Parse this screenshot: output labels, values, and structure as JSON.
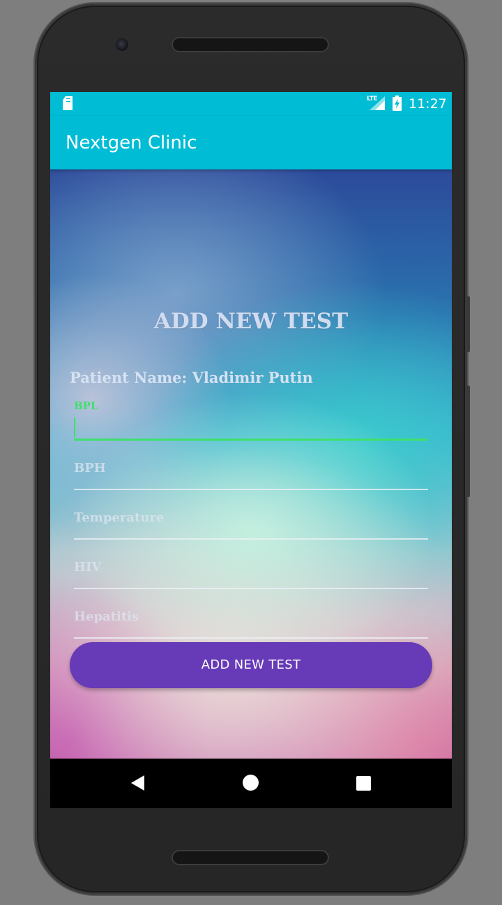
{
  "status_bar": {
    "network_label": "LTE",
    "time": "11:27",
    "icons": [
      "sd-card-icon",
      "signal-icon",
      "battery-charging-icon"
    ]
  },
  "app_bar": {
    "title": "Nextgen Clinic"
  },
  "form": {
    "heading": "ADD NEW TEST",
    "patient_line": "Patient Name: Vladimir Putin",
    "fields": [
      {
        "label": "BPL",
        "value": "",
        "focused": true
      },
      {
        "placeholder": "BPH",
        "value": ""
      },
      {
        "placeholder": "Temperature",
        "value": ""
      },
      {
        "placeholder": "HIV",
        "value": ""
      },
      {
        "placeholder": "Hepatitis",
        "value": ""
      }
    ],
    "submit_label": "ADD NEW TEST"
  },
  "nav_bar": {
    "icons": [
      "back-icon",
      "home-icon",
      "recents-icon"
    ]
  },
  "colors": {
    "primary": "#00bcd4",
    "accent": "#673ab7",
    "focus": "#3ee06b"
  }
}
